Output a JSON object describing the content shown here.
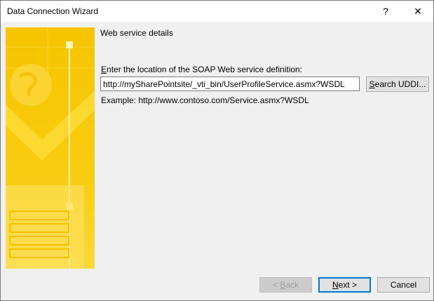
{
  "window": {
    "title": "Data Connection Wizard",
    "help_glyph": "?",
    "close_glyph": "✕"
  },
  "content": {
    "section_title": "Web service details",
    "prompt_accel": "E",
    "prompt_rest": "nter the location of the SOAP Web service definition:",
    "url_value": "http://mySharePointsite/_vti_bin/UserProfileService.asmx?WSDL",
    "example": "Example: http://www.contoso.com/Service.asmx?WSDL"
  },
  "buttons": {
    "search_accel": "S",
    "search_rest": "earch UDDI...",
    "back_arrow": "< ",
    "back_accel": "B",
    "back_rest": "ack",
    "next_accel": "N",
    "next_rest": "ext >",
    "cancel": "Cancel"
  },
  "colors": {
    "banner_yellow": "#f7c600",
    "banner_light": "#ffe066",
    "focus_blue": "#0078d7"
  }
}
